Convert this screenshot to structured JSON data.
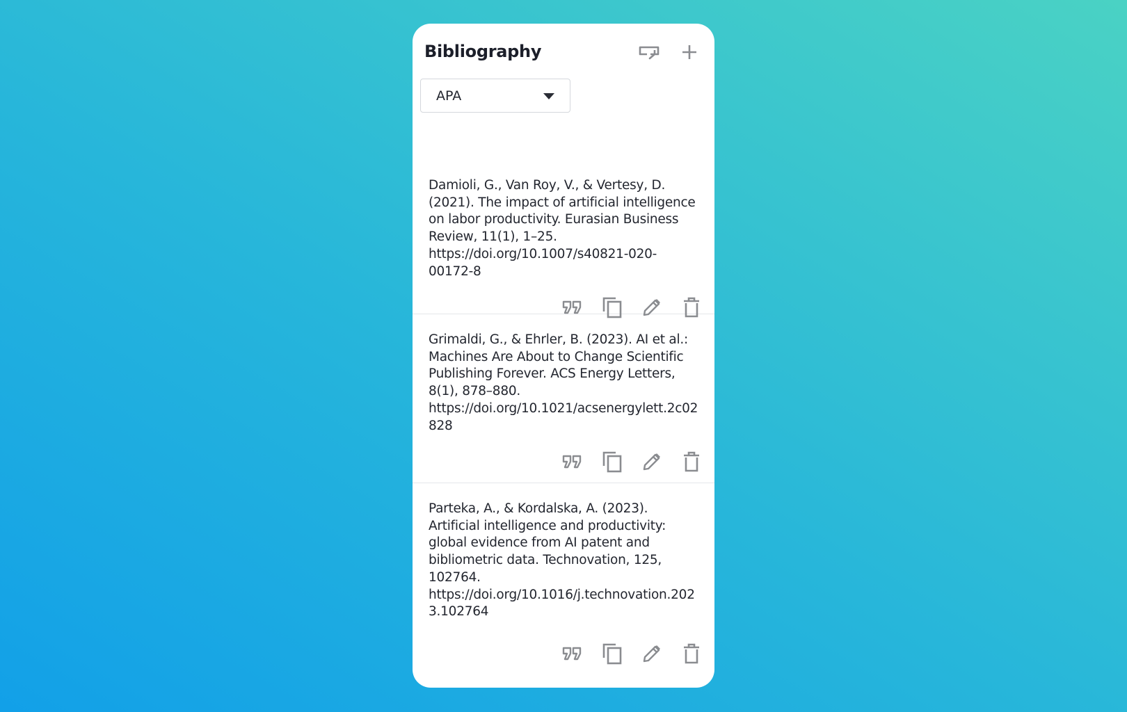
{
  "panel": {
    "title": "Bibliography",
    "import_icon": "import-icon",
    "add_icon": "plus-icon"
  },
  "style_select": {
    "value": "APA",
    "icon": "caret-down-icon"
  },
  "entries": [
    {
      "text": "Damioli, G., Van Roy, V., & Vertesy, D. (2021). The impact of artificial intelligence on labor productivity. Eurasian Business Review, 11(1), 1–25. https://doi.org/10.1007/s40821-020-00172-8"
    },
    {
      "text": "Grimaldi, G., & Ehrler, B. (2023). AI et al.: Machines Are About to Change Scientific Publishing Forever. ACS Energy Letters, 8(1), 878–880. https://doi.org/10.1021/acsenergylett.2c02828"
    },
    {
      "text": "Parteka, A., & Kordalska, A. (2023). Artificial intelligence and productivity: global evidence from AI patent and bibliometric data. Technovation, 125, 102764. https://doi.org/10.1016/j.technovation.2023.102764"
    }
  ],
  "entry_actions": [
    "quote-icon",
    "copy-icon",
    "edit-icon",
    "delete-icon"
  ],
  "colors": {
    "background_start": "#12a0e8",
    "background_end": "#4ad2c4",
    "panel": "#ffffff",
    "text": "#23262f",
    "icon": "#8a8c90"
  }
}
